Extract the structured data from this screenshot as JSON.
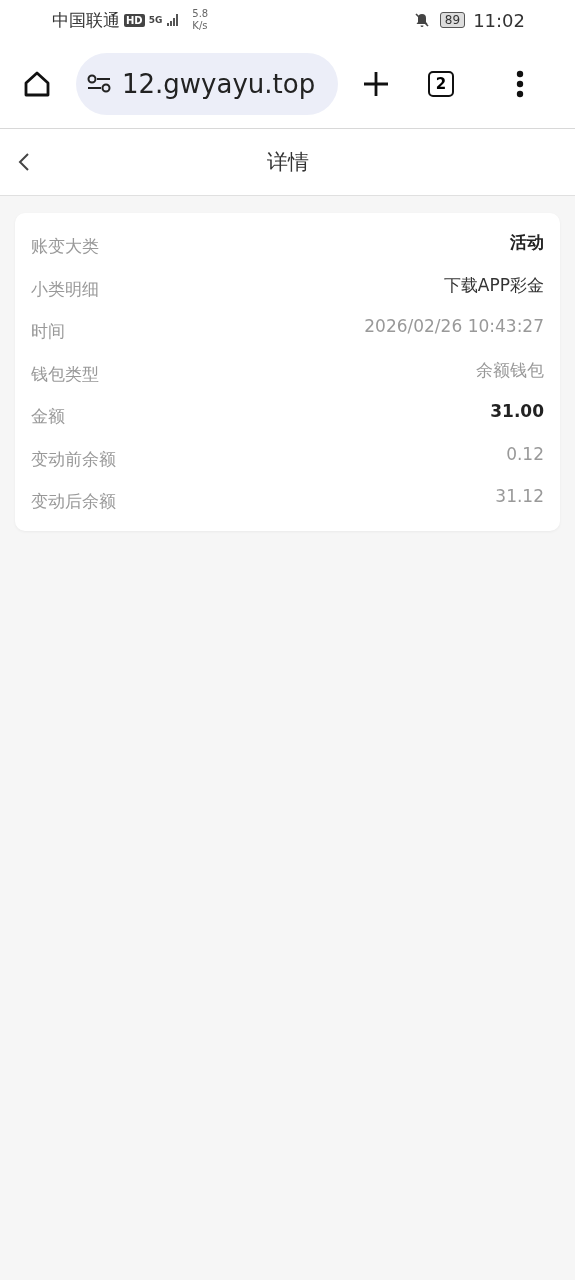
{
  "status_bar": {
    "carrier": "中国联通",
    "hd": "HD",
    "network": "5G",
    "speed_value": "5.8",
    "speed_unit": "K/s",
    "battery": "89",
    "time": "11:02"
  },
  "browser": {
    "url": "12.gwyayu.top",
    "tab_count": "2"
  },
  "header": {
    "title": "详情"
  },
  "details": [
    {
      "label": "账变大类",
      "value": "活动",
      "kind": "strong"
    },
    {
      "label": "小类明细",
      "value": "下载APP彩金",
      "kind": "plain"
    },
    {
      "label": "时间",
      "value": "2026/02/26 10:43:27",
      "kind": "muted"
    },
    {
      "label": "钱包类型",
      "value": "余额钱包",
      "kind": "muted"
    },
    {
      "label": "金额",
      "value": "31.00",
      "kind": "strong"
    },
    {
      "label": "变动前余额",
      "value": "0.12",
      "kind": "muted"
    },
    {
      "label": "变动后余额",
      "value": "31.12",
      "kind": "muted"
    }
  ]
}
